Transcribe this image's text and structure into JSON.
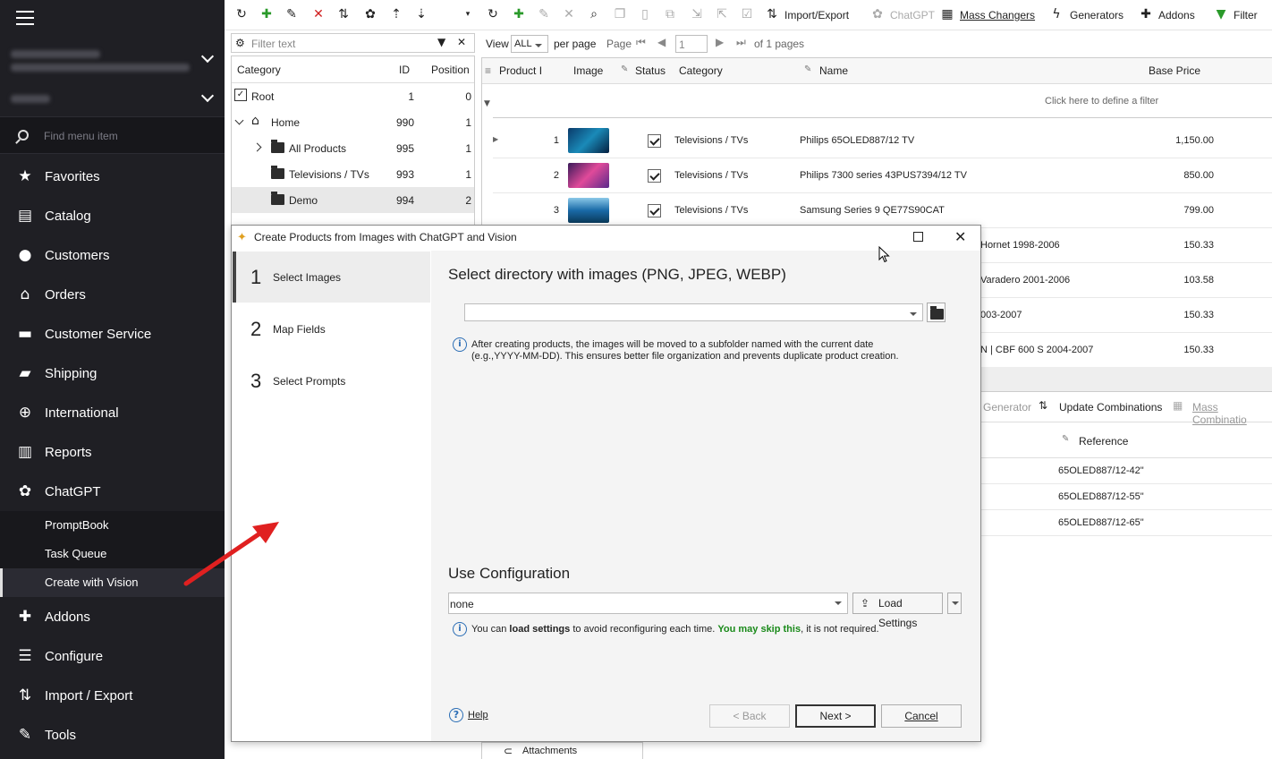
{
  "sidebar": {
    "search_placeholder": "Find menu item",
    "items": [
      {
        "label": "Favorites",
        "icon": "star-icon"
      },
      {
        "label": "Catalog",
        "icon": "catalog-icon"
      },
      {
        "label": "Customers",
        "icon": "user-icon"
      },
      {
        "label": "Orders",
        "icon": "basket-icon"
      },
      {
        "label": "Customer Service",
        "icon": "chat-icon"
      },
      {
        "label": "Shipping",
        "icon": "truck-icon"
      },
      {
        "label": "International",
        "icon": "globe-icon"
      },
      {
        "label": "Reports",
        "icon": "chart-icon"
      },
      {
        "label": "ChatGPT",
        "icon": "chatgpt-icon"
      },
      {
        "label": "Addons",
        "icon": "puzzle-icon"
      },
      {
        "label": "Configure",
        "icon": "sliders-icon"
      },
      {
        "label": "Import / Export",
        "icon": "import-export-icon"
      },
      {
        "label": "Tools",
        "icon": "wrench-icon"
      }
    ],
    "subitems": [
      {
        "label": "PromptBook"
      },
      {
        "label": "Task Queue"
      },
      {
        "label": "Create with Vision"
      }
    ]
  },
  "category_panel": {
    "filter_placeholder": "Filter text",
    "headers": {
      "category": "Category",
      "id": "ID",
      "position": "Position"
    },
    "rows": [
      {
        "name": "Root",
        "id": "1",
        "position": "0"
      },
      {
        "name": "Home",
        "id": "990",
        "position": "1"
      },
      {
        "name": "All Products",
        "id": "995",
        "position": "1"
      },
      {
        "name": "Televisions / TVs",
        "id": "993",
        "position": "1"
      },
      {
        "name": "Demo",
        "id": "994",
        "position": "2"
      }
    ]
  },
  "toolbar": {
    "import_export": "Import/Export",
    "chatgpt": "ChatGPT",
    "mass_changers": "Mass Changers",
    "generators": "Generators",
    "addons": "Addons",
    "filter": "Filter"
  },
  "pager": {
    "view_label": "View",
    "view_value": "ALL",
    "per_page": "per page",
    "page_label": "Page",
    "page_value": "1",
    "of_pages": "of 1 pages"
  },
  "grid": {
    "headers": {
      "product": "Product I",
      "image": "Image",
      "status": "Status",
      "category": "Category",
      "name": "Name",
      "base_price": "Base Price"
    },
    "filter_hint": "Click here to define a filter",
    "rows": [
      {
        "num": "1",
        "category": "Televisions / TVs",
        "name": "Philips 65OLED887/12 TV",
        "price": "1,150.00"
      },
      {
        "num": "2",
        "category": "Televisions / TVs",
        "name": "Philips 7300 series 43PUS7394/12 TV",
        "price": "850.00"
      },
      {
        "num": "3",
        "category": "Televisions / TVs",
        "name": "Samsung Series 9 QE77S90CAT",
        "price": "799.00"
      }
    ],
    "partial_rows": [
      {
        "name": "Hornet 1998-2006",
        "price": "150.33"
      },
      {
        "name": "Varadero 2001-2006",
        "price": "103.58"
      },
      {
        "name": "003-2007",
        "price": "150.33"
      },
      {
        "name": "N | CBF 600 S 2004-2007",
        "price": "150.33"
      }
    ]
  },
  "lower": {
    "generator": "Generator",
    "update_combinations": "Update Combinations",
    "mass_combinations": "Mass Combinatio",
    "reference_header": "Reference",
    "references": [
      "65OLED887/12-42\"",
      "65OLED887/12-55\"",
      "65OLED887/12-65\""
    ],
    "attachments": "Attachments"
  },
  "dialog": {
    "title": "Create Products from Images with ChatGPT and Vision",
    "steps": [
      {
        "num": "1",
        "label": "Select Images"
      },
      {
        "num": "2",
        "label": "Map Fields"
      },
      {
        "num": "3",
        "label": "Select Prompts"
      }
    ],
    "heading": "Select directory with images (PNG, JPEG, WEBP)",
    "dir_value": "",
    "info_line1": "After creating products, the images will be moved to a subfolder named with the current date",
    "info_line2": "(e.g.,YYYY-MM-DD). This ensures better file organization and prevents duplicate product creation.",
    "config_heading": "Use Configuration",
    "config_value": "none",
    "load_settings": "Load Settings",
    "config_info_a": "You can ",
    "config_info_b": "load settings",
    "config_info_c": " to avoid reconfiguring each time. ",
    "config_info_d": "You may skip this",
    "config_info_e": ", it is not required.",
    "help": "Help",
    "back": "< Back",
    "next": "Next >",
    "cancel": "Cancel"
  },
  "colors": {
    "accent_arrow": "#e02020",
    "skip_green": "#1a8a1a"
  }
}
